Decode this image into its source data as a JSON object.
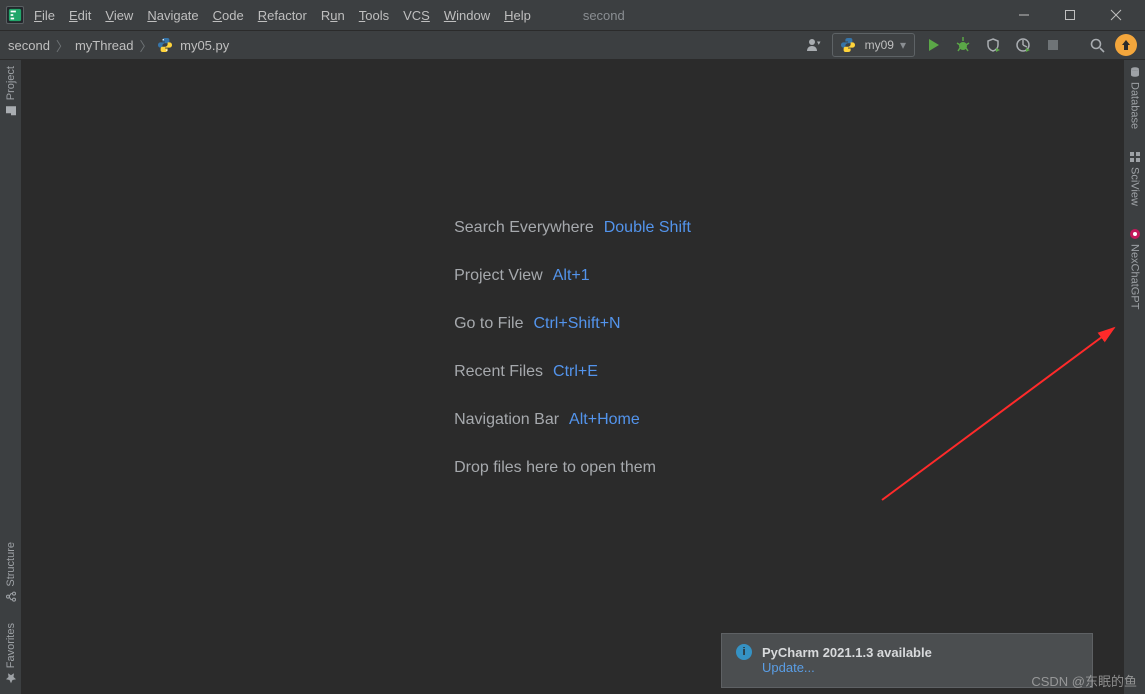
{
  "window": {
    "title": "second"
  },
  "menu": {
    "file": "File",
    "edit": "Edit",
    "view": "View",
    "navigate": "Navigate",
    "code": "Code",
    "refactor": "Refactor",
    "run": "Run",
    "tools": "Tools",
    "vcs": "VCS",
    "window_m": "Window",
    "help": "Help"
  },
  "breadcrumb": {
    "proj": "second",
    "dir": "myThread",
    "file": "my05.py"
  },
  "runConfig": {
    "name": "my09"
  },
  "leftTools": {
    "project": "Project",
    "structure": "Structure",
    "favorites": "Favorites"
  },
  "rightTools": {
    "database": "Database",
    "sciview": "SciView",
    "nexchat": "NexChatGPT"
  },
  "hints": {
    "search_l": "Search Everywhere",
    "search_k": "Double Shift",
    "project_l": "Project View",
    "project_k": "Alt+1",
    "goto_l": "Go to File",
    "goto_k": "Ctrl+Shift+N",
    "recent_l": "Recent Files",
    "recent_k": "Ctrl+E",
    "navbar_l": "Navigation Bar",
    "navbar_k": "Alt+Home",
    "drop": "Drop files here to open them"
  },
  "notification": {
    "title": "PyCharm 2021.1.3 available",
    "action": "Update..."
  },
  "watermark": "CSDN @东眠的鱼"
}
